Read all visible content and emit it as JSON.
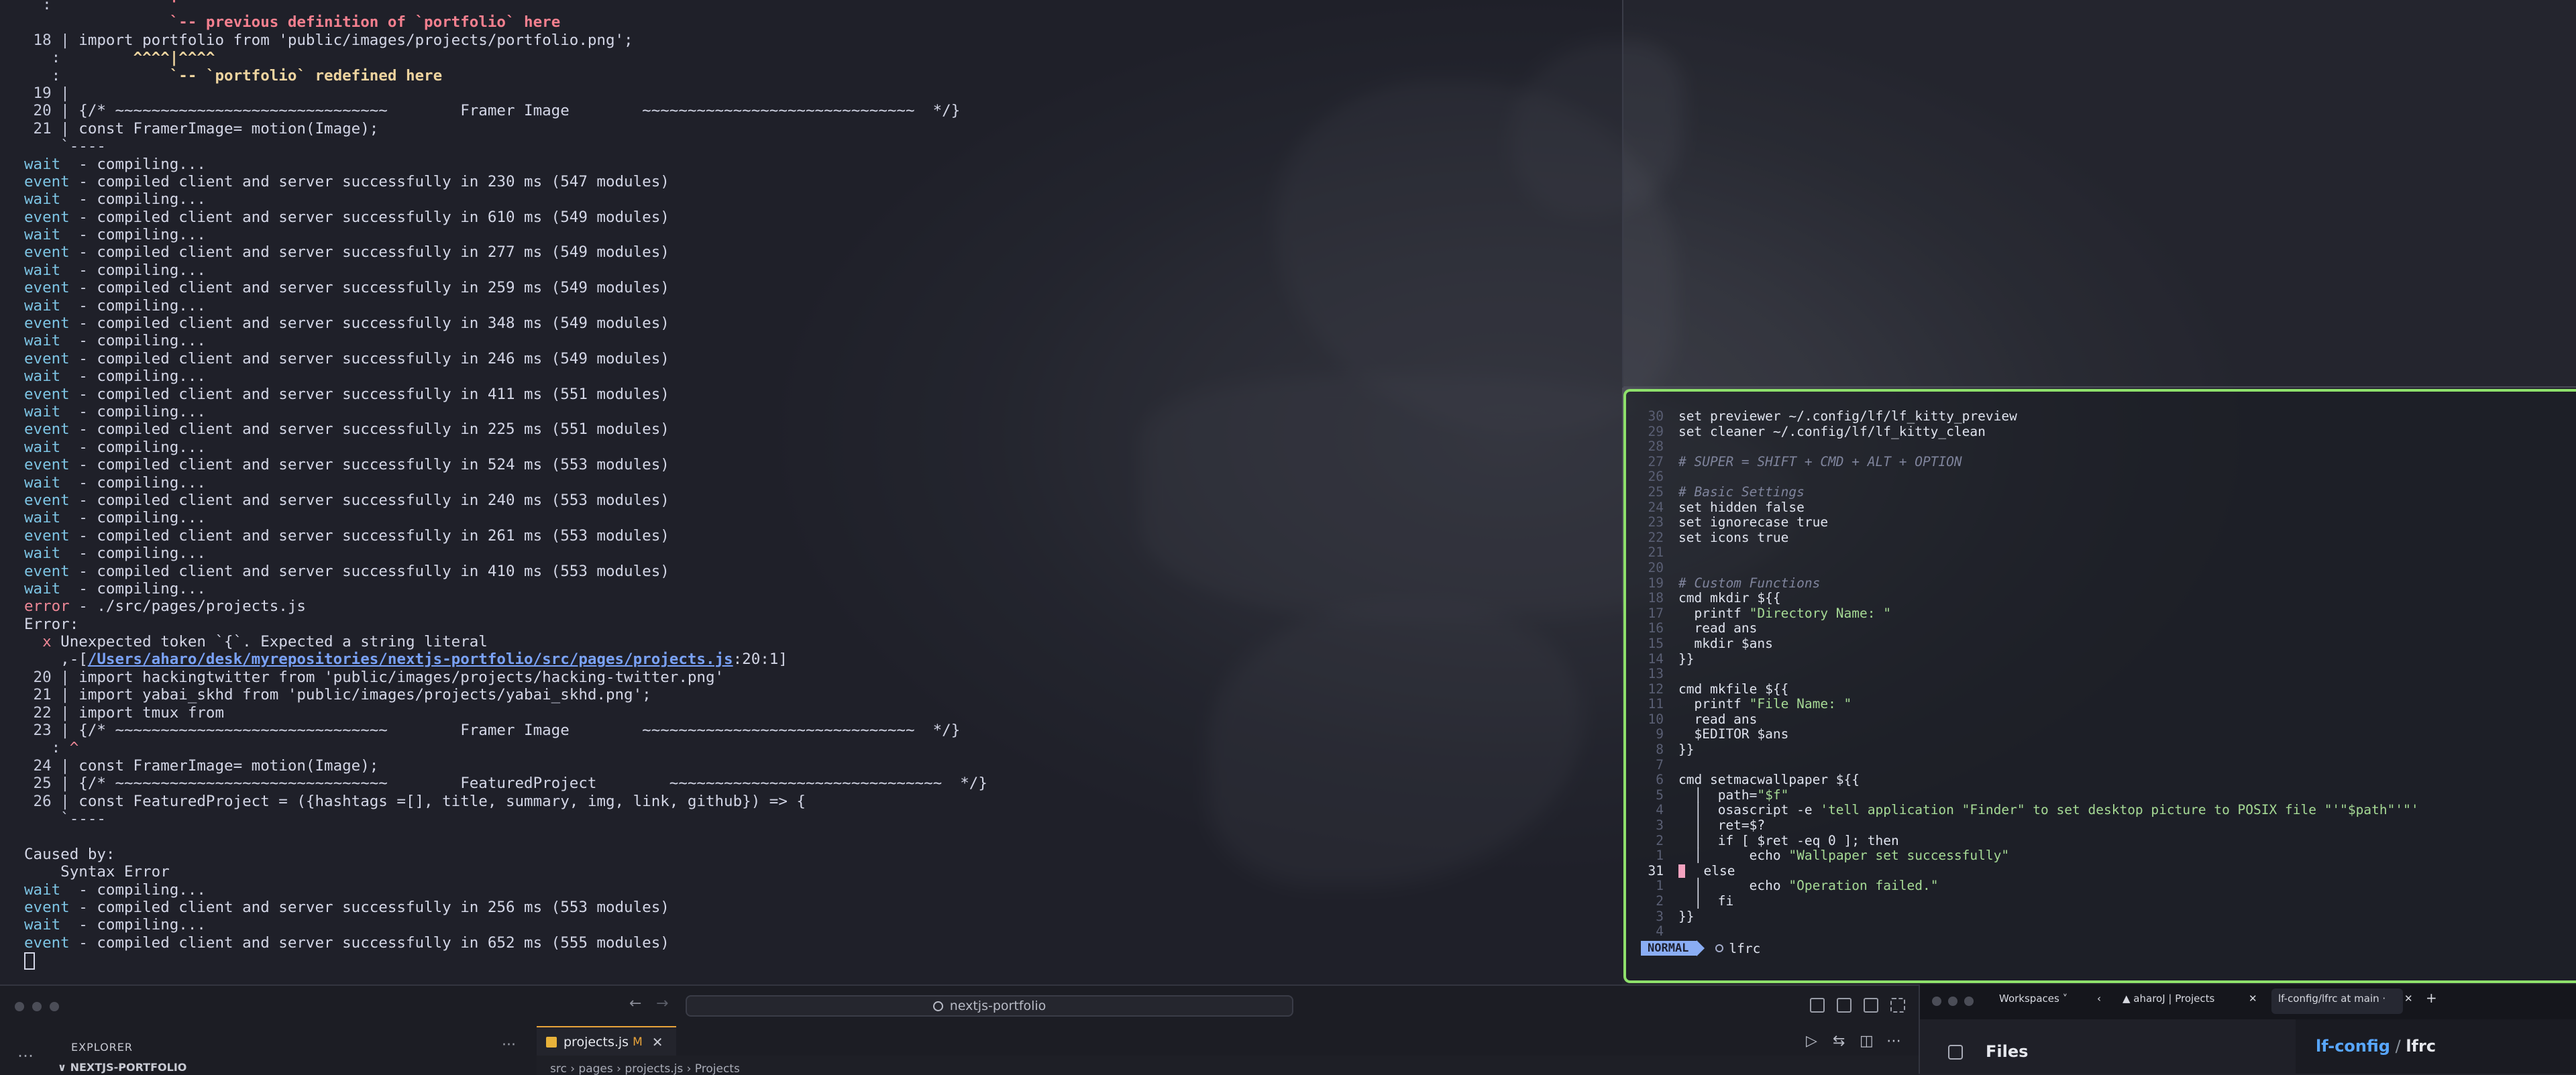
{
  "terminal": {
    "lines": [
      {
        "gutter": "  :",
        "parts": [
          {
            "t": "             ",
            "c": ""
          },
          {
            "t": "'",
            "c": "tr"
          }
        ]
      },
      {
        "gutter": "   ",
        "parts": [
          {
            "t": "             ",
            "c": ""
          },
          {
            "t": "`-- previous definition of `portfolio` here",
            "c": "tr"
          }
        ]
      },
      {
        "gutter": " 18 |",
        "parts": [
          {
            "t": " import portfolio from 'public/images/projects/portfolio.png';",
            "c": ""
          }
        ]
      },
      {
        "gutter": "   :",
        "parts": [
          {
            "t": "        ",
            "c": ""
          },
          {
            "t": "^^^^|^^^^",
            "c": "ty"
          }
        ]
      },
      {
        "gutter": "   :",
        "parts": [
          {
            "t": "            ",
            "c": ""
          },
          {
            "t": "`-- `portfolio` redefined here",
            "c": "ty"
          }
        ]
      },
      {
        "gutter": " 19 |",
        "parts": []
      },
      {
        "gutter": " 20 |",
        "parts": [
          {
            "t": " {/* ~~~~~~~~~~~~~~~~~~~~~~~~~~~~~~        Framer Image        ~~~~~~~~~~~~~~~~~~~~~~~~~~~~~~  */}",
            "c": ""
          }
        ]
      },
      {
        "gutter": " 21 |",
        "parts": [
          {
            "t": " const FramerImage= motion(Image);",
            "c": ""
          }
        ]
      },
      {
        "gutter": "    `----",
        "parts": []
      },
      {
        "gutter": "",
        "parts": [
          {
            "t": "wait",
            "c": "tw"
          },
          {
            "t": "  - compiling...",
            "c": ""
          }
        ]
      },
      {
        "gutter": "",
        "parts": [
          {
            "t": "event",
            "c": "tw"
          },
          {
            "t": " - compiled client and server successfully in 230 ms (547 modules)",
            "c": ""
          }
        ]
      },
      {
        "gutter": "",
        "parts": [
          {
            "t": "wait",
            "c": "tw"
          },
          {
            "t": "  - compiling...",
            "c": ""
          }
        ]
      },
      {
        "gutter": "",
        "parts": [
          {
            "t": "event",
            "c": "tw"
          },
          {
            "t": " - compiled client and server successfully in 610 ms (549 modules)",
            "c": ""
          }
        ]
      },
      {
        "gutter": "",
        "parts": [
          {
            "t": "wait",
            "c": "tw"
          },
          {
            "t": "  - compiling...",
            "c": ""
          }
        ]
      },
      {
        "gutter": "",
        "parts": [
          {
            "t": "event",
            "c": "tw"
          },
          {
            "t": " - compiled client and server successfully in 277 ms (549 modules)",
            "c": ""
          }
        ]
      },
      {
        "gutter": "",
        "parts": [
          {
            "t": "wait",
            "c": "tw"
          },
          {
            "t": "  - compiling...",
            "c": ""
          }
        ]
      },
      {
        "gutter": "",
        "parts": [
          {
            "t": "event",
            "c": "tw"
          },
          {
            "t": " - compiled client and server successfully in 259 ms (549 modules)",
            "c": ""
          }
        ]
      },
      {
        "gutter": "",
        "parts": [
          {
            "t": "wait",
            "c": "tw"
          },
          {
            "t": "  - compiling...",
            "c": ""
          }
        ]
      },
      {
        "gutter": "",
        "parts": [
          {
            "t": "event",
            "c": "tw"
          },
          {
            "t": " - compiled client and server successfully in 348 ms (549 modules)",
            "c": ""
          }
        ]
      },
      {
        "gutter": "",
        "parts": [
          {
            "t": "wait",
            "c": "tw"
          },
          {
            "t": "  - compiling...",
            "c": ""
          }
        ]
      },
      {
        "gutter": "",
        "parts": [
          {
            "t": "event",
            "c": "tw"
          },
          {
            "t": " - compiled client and server successfully in 246 ms (549 modules)",
            "c": ""
          }
        ]
      },
      {
        "gutter": "",
        "parts": [
          {
            "t": "wait",
            "c": "tw"
          },
          {
            "t": "  - compiling...",
            "c": ""
          }
        ]
      },
      {
        "gutter": "",
        "parts": [
          {
            "t": "event",
            "c": "tw"
          },
          {
            "t": " - compiled client and server successfully in 411 ms (551 modules)",
            "c": ""
          }
        ]
      },
      {
        "gutter": "",
        "parts": [
          {
            "t": "wait",
            "c": "tw"
          },
          {
            "t": "  - compiling...",
            "c": ""
          }
        ]
      },
      {
        "gutter": "",
        "parts": [
          {
            "t": "event",
            "c": "tw"
          },
          {
            "t": " - compiled client and server successfully in 225 ms (551 modules)",
            "c": ""
          }
        ]
      },
      {
        "gutter": "",
        "parts": [
          {
            "t": "wait",
            "c": "tw"
          },
          {
            "t": "  - compiling...",
            "c": ""
          }
        ]
      },
      {
        "gutter": "",
        "parts": [
          {
            "t": "event",
            "c": "tw"
          },
          {
            "t": " - compiled client and server successfully in 524 ms (553 modules)",
            "c": ""
          }
        ]
      },
      {
        "gutter": "",
        "parts": [
          {
            "t": "wait",
            "c": "tw"
          },
          {
            "t": "  - compiling...",
            "c": ""
          }
        ]
      },
      {
        "gutter": "",
        "parts": [
          {
            "t": "event",
            "c": "tw"
          },
          {
            "t": " - compiled client and server successfully in 240 ms (553 modules)",
            "c": ""
          }
        ]
      },
      {
        "gutter": "",
        "parts": [
          {
            "t": "wait",
            "c": "tw"
          },
          {
            "t": "  - compiling...",
            "c": ""
          }
        ]
      },
      {
        "gutter": "",
        "parts": [
          {
            "t": "event",
            "c": "tw"
          },
          {
            "t": " - compiled client and server successfully in 261 ms (553 modules)",
            "c": ""
          }
        ]
      },
      {
        "gutter": "",
        "parts": [
          {
            "t": "wait",
            "c": "tw"
          },
          {
            "t": "  - compiling...",
            "c": ""
          }
        ]
      },
      {
        "gutter": "",
        "parts": [
          {
            "t": "event",
            "c": "tw"
          },
          {
            "t": " - compiled client and server successfully in 410 ms (553 modules)",
            "c": ""
          }
        ]
      },
      {
        "gutter": "",
        "parts": [
          {
            "t": "wait",
            "c": "tw"
          },
          {
            "t": "  - compiling...",
            "c": ""
          }
        ]
      },
      {
        "gutter": "",
        "parts": [
          {
            "t": "error",
            "c": "te"
          },
          {
            "t": " - ./src/pages/projects.js",
            "c": ""
          }
        ]
      },
      {
        "gutter": "",
        "parts": [
          {
            "t": "Error:",
            "c": ""
          }
        ]
      },
      {
        "gutter": "",
        "parts": [
          {
            "t": "  ",
            "c": ""
          },
          {
            "t": "x",
            "c": "te"
          },
          {
            "t": " Unexpected token `{`. Expected a string literal",
            "c": ""
          }
        ]
      },
      {
        "gutter": "",
        "parts": [
          {
            "t": "    ,-[",
            "c": ""
          },
          {
            "t": "/Users/aharo/desk/myrepositories/nextjs-portfolio/src/pages/projects.js",
            "c": "tb"
          },
          {
            "t": ":20:1]",
            "c": ""
          }
        ]
      },
      {
        "gutter": " 20 |",
        "parts": [
          {
            "t": " import hackingtwitter from 'public/images/projects/hacking-twitter.png'",
            "c": ""
          }
        ]
      },
      {
        "gutter": " 21 |",
        "parts": [
          {
            "t": " import yabai_skhd from 'public/images/projects/yabai_skhd.png';",
            "c": ""
          }
        ]
      },
      {
        "gutter": " 22 |",
        "parts": [
          {
            "t": " import tmux from",
            "c": ""
          }
        ]
      },
      {
        "gutter": " 23 |",
        "parts": [
          {
            "t": " {/* ~~~~~~~~~~~~~~~~~~~~~~~~~~~~~~        Framer Image        ~~~~~~~~~~~~~~~~~~~~~~~~~~~~~~  */}",
            "c": ""
          }
        ]
      },
      {
        "gutter": "   :",
        "parts": [
          {
            "t": " ",
            "c": ""
          },
          {
            "t": "^",
            "c": "te"
          }
        ]
      },
      {
        "gutter": " 24 |",
        "parts": [
          {
            "t": " const FramerImage= motion(Image);",
            "c": ""
          }
        ]
      },
      {
        "gutter": " 25 |",
        "parts": [
          {
            "t": " {/* ~~~~~~~~~~~~~~~~~~~~~~~~~~~~~~        FeaturedProject        ~~~~~~~~~~~~~~~~~~~~~~~~~~~~~~  */}",
            "c": ""
          }
        ]
      },
      {
        "gutter": " 26 |",
        "parts": [
          {
            "t": " const FeaturedProject = ({hashtags =[], title, summary, img, link, github}) => {",
            "c": ""
          }
        ]
      },
      {
        "gutter": "    `----",
        "parts": []
      },
      {
        "gutter": "",
        "parts": []
      },
      {
        "gutter": "",
        "parts": [
          {
            "t": "Caused by:",
            "c": ""
          }
        ]
      },
      {
        "gutter": "",
        "parts": [
          {
            "t": "    Syntax Error",
            "c": ""
          }
        ]
      },
      {
        "gutter": "",
        "parts": [
          {
            "t": "wait",
            "c": "tw"
          },
          {
            "t": "  - compiling...",
            "c": ""
          }
        ]
      },
      {
        "gutter": "",
        "parts": [
          {
            "t": "event",
            "c": "tw"
          },
          {
            "t": " - compiled client and server successfully in 256 ms (553 modules)",
            "c": ""
          }
        ]
      },
      {
        "gutter": "",
        "parts": [
          {
            "t": "wait",
            "c": "tw"
          },
          {
            "t": "  - compiling...",
            "c": ""
          }
        ]
      },
      {
        "gutter": "",
        "parts": [
          {
            "t": "event",
            "c": "tw"
          },
          {
            "t": " - compiled client and server successfully in 652 ms (555 modules)",
            "c": ""
          }
        ]
      },
      {
        "gutter": "",
        "parts": [],
        "cursor": true
      }
    ]
  },
  "lf_editor": {
    "lines": [
      {
        "n": "30",
        "parts": [
          {
            "t": "set previewer ~/.config/lf/lf_kitty_preview",
            "c": ""
          }
        ]
      },
      {
        "n": "29",
        "parts": [
          {
            "t": "set cleaner ~/.config/lf/lf_kitty_clean",
            "c": ""
          }
        ]
      },
      {
        "n": "28",
        "parts": []
      },
      {
        "n": "27",
        "parts": [
          {
            "t": "# SUPER = SHIFT + CMD + ALT + OPTION",
            "c": "cm"
          }
        ]
      },
      {
        "n": "26",
        "parts": []
      },
      {
        "n": "25",
        "parts": [
          {
            "t": "# Basic Settings",
            "c": "cm"
          }
        ]
      },
      {
        "n": "24",
        "parts": [
          {
            "t": "set hidden false",
            "c": ""
          }
        ]
      },
      {
        "n": "23",
        "parts": [
          {
            "t": "set ignorecase true",
            "c": ""
          }
        ]
      },
      {
        "n": "22",
        "parts": [
          {
            "t": "set icons true",
            "c": ""
          }
        ]
      },
      {
        "n": "21",
        "parts": []
      },
      {
        "n": "20",
        "parts": []
      },
      {
        "n": "19",
        "parts": [
          {
            "t": "# Custom Functions",
            "c": "cm"
          }
        ]
      },
      {
        "n": "18",
        "parts": [
          {
            "t": "cmd mkdir ${{",
            "c": ""
          }
        ]
      },
      {
        "n": "17",
        "parts": [
          {
            "t": "  printf ",
            "c": ""
          },
          {
            "t": "\"Directory Name: \"",
            "c": "st"
          }
        ]
      },
      {
        "n": "16",
        "parts": [
          {
            "t": "  read ans",
            "c": ""
          }
        ]
      },
      {
        "n": "15",
        "parts": [
          {
            "t": "  mkdir $ans",
            "c": ""
          }
        ]
      },
      {
        "n": "14",
        "parts": [
          {
            "t": "}}",
            "c": ""
          }
        ]
      },
      {
        "n": "13",
        "parts": []
      },
      {
        "n": "12",
        "parts": [
          {
            "t": "cmd mkfile ${{",
            "c": ""
          }
        ]
      },
      {
        "n": "11",
        "parts": [
          {
            "t": "  printf ",
            "c": ""
          },
          {
            "t": "\"File Name: \"",
            "c": "st"
          }
        ]
      },
      {
        "n": "10",
        "parts": [
          {
            "t": "  read ans",
            "c": ""
          }
        ]
      },
      {
        "n": "9",
        "parts": [
          {
            "t": "  $EDITOR $ans",
            "c": ""
          }
        ]
      },
      {
        "n": "8",
        "parts": [
          {
            "t": "}}",
            "c": ""
          }
        ]
      },
      {
        "n": "7",
        "parts": []
      },
      {
        "n": "6",
        "parts": [
          {
            "t": "cmd setmacwallpaper ${{",
            "c": ""
          }
        ]
      },
      {
        "n": "5",
        "parts": [
          {
            "t": "  │  path=",
            "c": ""
          },
          {
            "t": "\"$f\"",
            "c": "st"
          }
        ]
      },
      {
        "n": "4",
        "parts": [
          {
            "t": "  │  osascript -e ",
            "c": ""
          },
          {
            "t": "'tell application \"Finder\" to set desktop picture to POSIX file \"'\"$path\"'\"'",
            "c": "st"
          }
        ]
      },
      {
        "n": "3",
        "parts": [
          {
            "t": "  │  ret=$?",
            "c": ""
          }
        ]
      },
      {
        "n": "2",
        "parts": [
          {
            "t": "  │  if [ $ret -eq 0 ]; then",
            "c": ""
          }
        ]
      },
      {
        "n": "1",
        "parts": [
          {
            "t": "  │      echo ",
            "c": ""
          },
          {
            "t": "\"Wallpaper set successfully\"",
            "c": "st"
          }
        ]
      },
      {
        "n": "31",
        "current": true,
        "parts": [
          {
            "t": "  else",
            "c": ""
          }
        ]
      },
      {
        "n": "1",
        "parts": [
          {
            "t": "  │      echo ",
            "c": ""
          },
          {
            "t": "\"Operation failed.\"",
            "c": "st"
          }
        ]
      },
      {
        "n": "2",
        "parts": [
          {
            "t": "  │  fi",
            "c": ""
          }
        ]
      },
      {
        "n": "3",
        "parts": [
          {
            "t": "}}",
            "c": ""
          }
        ]
      },
      {
        "n": "4",
        "parts": []
      }
    ],
    "status": {
      "mode": "NORMAL",
      "filename": "lfrc"
    }
  },
  "vscode": {
    "command_center": "nextjs-portfolio",
    "explorer_title": "EXPLORER",
    "more_label": "···",
    "activity_more": "…",
    "folder_name": "∨ NEXTJS-PORTFOLIO",
    "tab": {
      "name": "projects.js",
      "modified": "M",
      "close": "✕"
    },
    "breadcrumb": "src  ›  pages  ›  projects.js  ›  Projects"
  },
  "browser": {
    "workspaces": "Workspaces ˅",
    "tab1": "▲  aharoJ | Projects",
    "tab1_close": "✕",
    "tab2": "lf-config/lfrc at main ·",
    "tab2_close": "✕",
    "new_tab": "+",
    "files_title": "Files",
    "path_repo": "lf-config",
    "path_sep": " / ",
    "path_file": "lfrc"
  }
}
